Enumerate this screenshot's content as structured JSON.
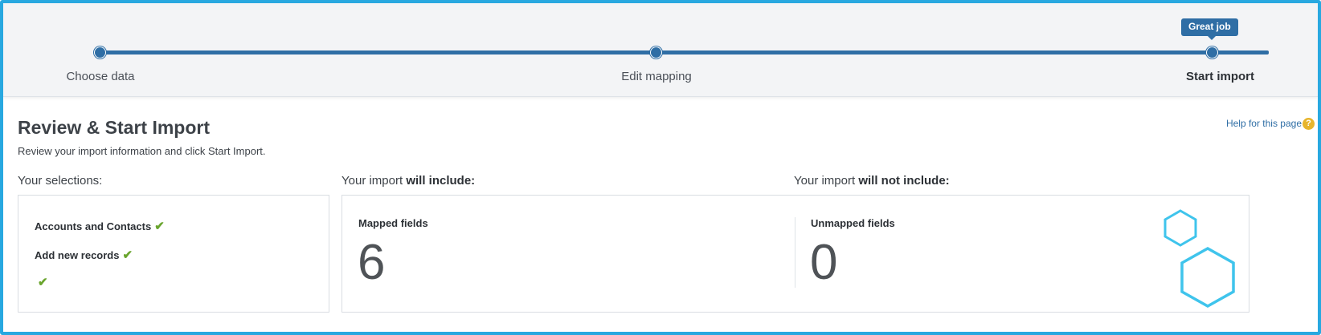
{
  "stepper": {
    "steps": [
      {
        "label": "Choose data"
      },
      {
        "label": "Edit mapping"
      },
      {
        "label": "Start import",
        "badge": "Great job"
      }
    ]
  },
  "page": {
    "title": "Review & Start Import",
    "subtitle": "Review your import information and click Start Import.",
    "help_link": "Help for this page",
    "help_icon": "?"
  },
  "selections": {
    "heading": "Your selections:",
    "items": [
      "Accounts and Contacts",
      "Add new records",
      ""
    ],
    "check_icon": "checkmark-icon",
    "check_color": "#6aa52e"
  },
  "import_summary": {
    "include_heading_prefix": "Your import",
    "include_heading_bold": "will include:",
    "exclude_heading_prefix": "Your import",
    "exclude_heading_bold": "will not include:",
    "mapped_label": "Mapped fields",
    "mapped_count": "6",
    "unmapped_label": "Unmapped fields",
    "unmapped_count": "0"
  },
  "colors": {
    "accent": "#2f6ea5",
    "frame": "#28a8e0",
    "hexagon": "#3fc4ec",
    "help_icon": "#e7b52d"
  }
}
